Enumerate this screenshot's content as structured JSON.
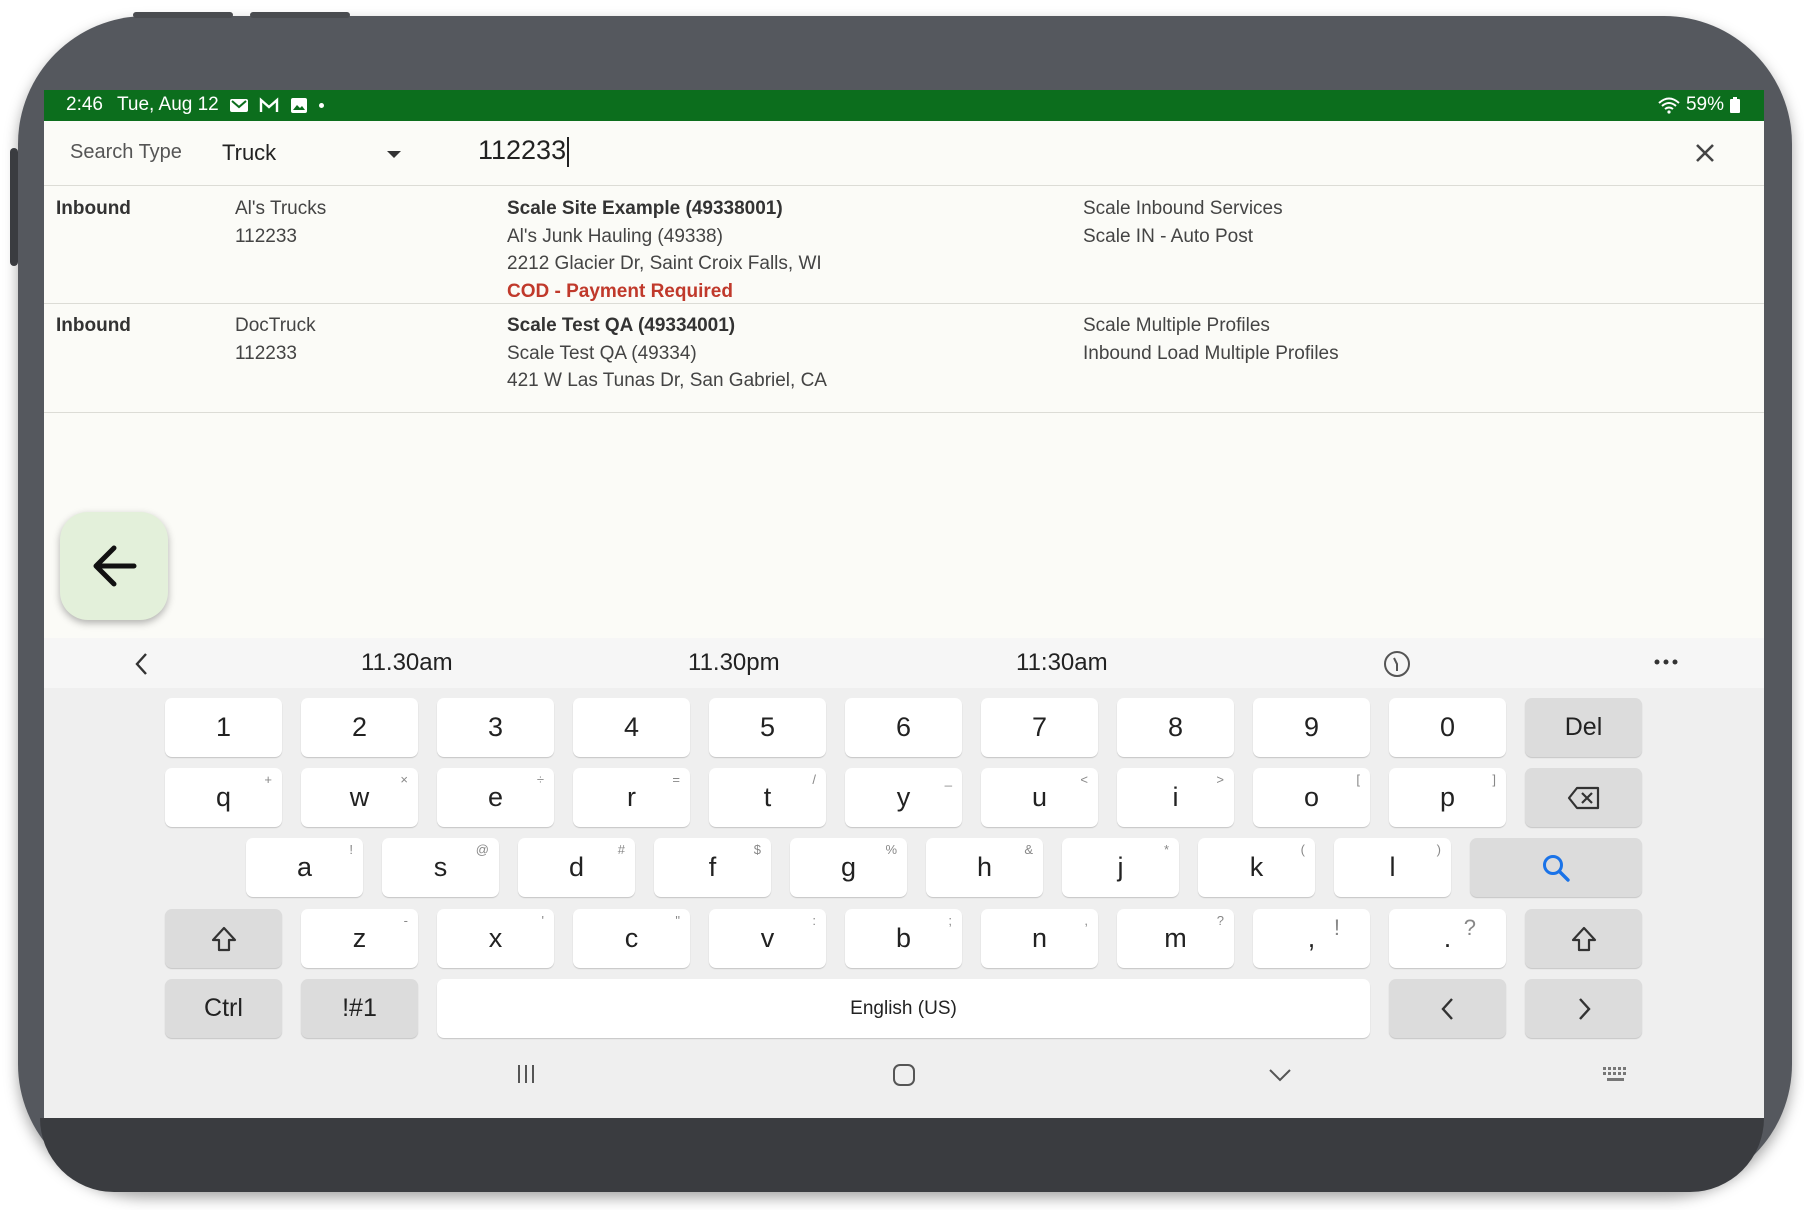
{
  "status_bar": {
    "time": "2:46",
    "date": "Tue, Aug 12",
    "battery": "59%"
  },
  "search": {
    "type_label": "Search Type",
    "type_value": "Truck",
    "query": "112233"
  },
  "results": [
    {
      "direction": "Inbound",
      "truck_name": "Al's Trucks",
      "truck_number": "112233",
      "site": "Scale Site Example (49338001)",
      "customer": "Al's Junk Hauling (49338)",
      "address": "2212 Glacier Dr, Saint Croix Falls, WI",
      "alert": "COD - Payment Required",
      "service": "Scale Inbound Services",
      "profile": "Scale IN - Auto Post"
    },
    {
      "direction": "Inbound",
      "truck_name": "DocTruck",
      "truck_number": "112233",
      "site": "Scale Test QA (49334001)",
      "customer": "Scale Test QA (49334)",
      "address": "421 W Las Tunas Dr, San Gabriel, CA",
      "service": "Scale Multiple Profiles",
      "profile": "Inbound Load Multiple Profiles"
    }
  ],
  "keyboard": {
    "suggestions": [
      "11.30am",
      "11.30pm",
      "11:30am"
    ],
    "number_row": [
      "1",
      "2",
      "3",
      "4",
      "5",
      "6",
      "7",
      "8",
      "9",
      "0"
    ],
    "del_label": "Del",
    "row_q": [
      "q",
      "w",
      "e",
      "r",
      "t",
      "y",
      "u",
      "i",
      "o",
      "p"
    ],
    "row_q_sub": [
      "+",
      "×",
      "÷",
      "=",
      "/",
      "_",
      "<",
      ">",
      "[",
      "]"
    ],
    "row_a": [
      "a",
      "s",
      "d",
      "f",
      "g",
      "h",
      "j",
      "k",
      "l"
    ],
    "row_a_sub": [
      "!",
      "@",
      "#",
      "$",
      "%",
      "&",
      "*",
      "(",
      ")"
    ],
    "row_z": [
      "z",
      "x",
      "c",
      "v",
      "b",
      "n",
      "m",
      ",",
      "."
    ],
    "row_z_sub": [
      "-",
      "'",
      "\"",
      ":",
      ";",
      ",",
      "?",
      "!",
      "?"
    ],
    "ctrl_label": "Ctrl",
    "symbols_label": "!#1",
    "space_label": "English (US)"
  },
  "colors": {
    "status_bar": "#0c6e1d",
    "alert": "#c0392b",
    "fab": "#e3f0da",
    "search_key_icon": "#1a73e8"
  },
  "icons": [
    "email-icon",
    "gmail-icon",
    "image-icon",
    "wifi-icon",
    "battery-icon",
    "dropdown-caret-icon",
    "close-icon",
    "back-arrow-icon",
    "chevron-left-icon",
    "clipboard-icon",
    "more-icon",
    "backspace-icon",
    "search-icon",
    "shift-icon",
    "arrow-left-icon",
    "arrow-right-icon",
    "recent-apps-icon",
    "home-icon",
    "hide-keyboard-icon",
    "keyboard-icon"
  ]
}
